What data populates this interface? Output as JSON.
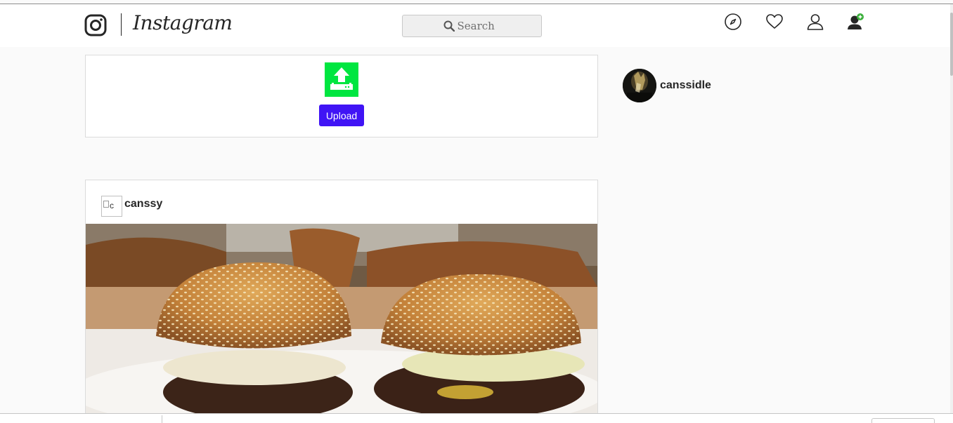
{
  "header": {
    "logo_text": "Instagram",
    "search": {
      "placeholder": "Search"
    },
    "icons": [
      "compass-icon",
      "heart-icon",
      "user-icon",
      "add-user-icon"
    ]
  },
  "upload": {
    "button_label": "Upload",
    "icon": "upload-icon",
    "icon_color": "#00e640",
    "button_color": "#4014f5"
  },
  "profile": {
    "username": "canssidle"
  },
  "post": {
    "avatar_alt": "c",
    "username": "canssy",
    "image": "burgers-photo"
  },
  "colors": {
    "background": "#fafafa",
    "text": "#262626",
    "border": "#dbdbdb"
  }
}
